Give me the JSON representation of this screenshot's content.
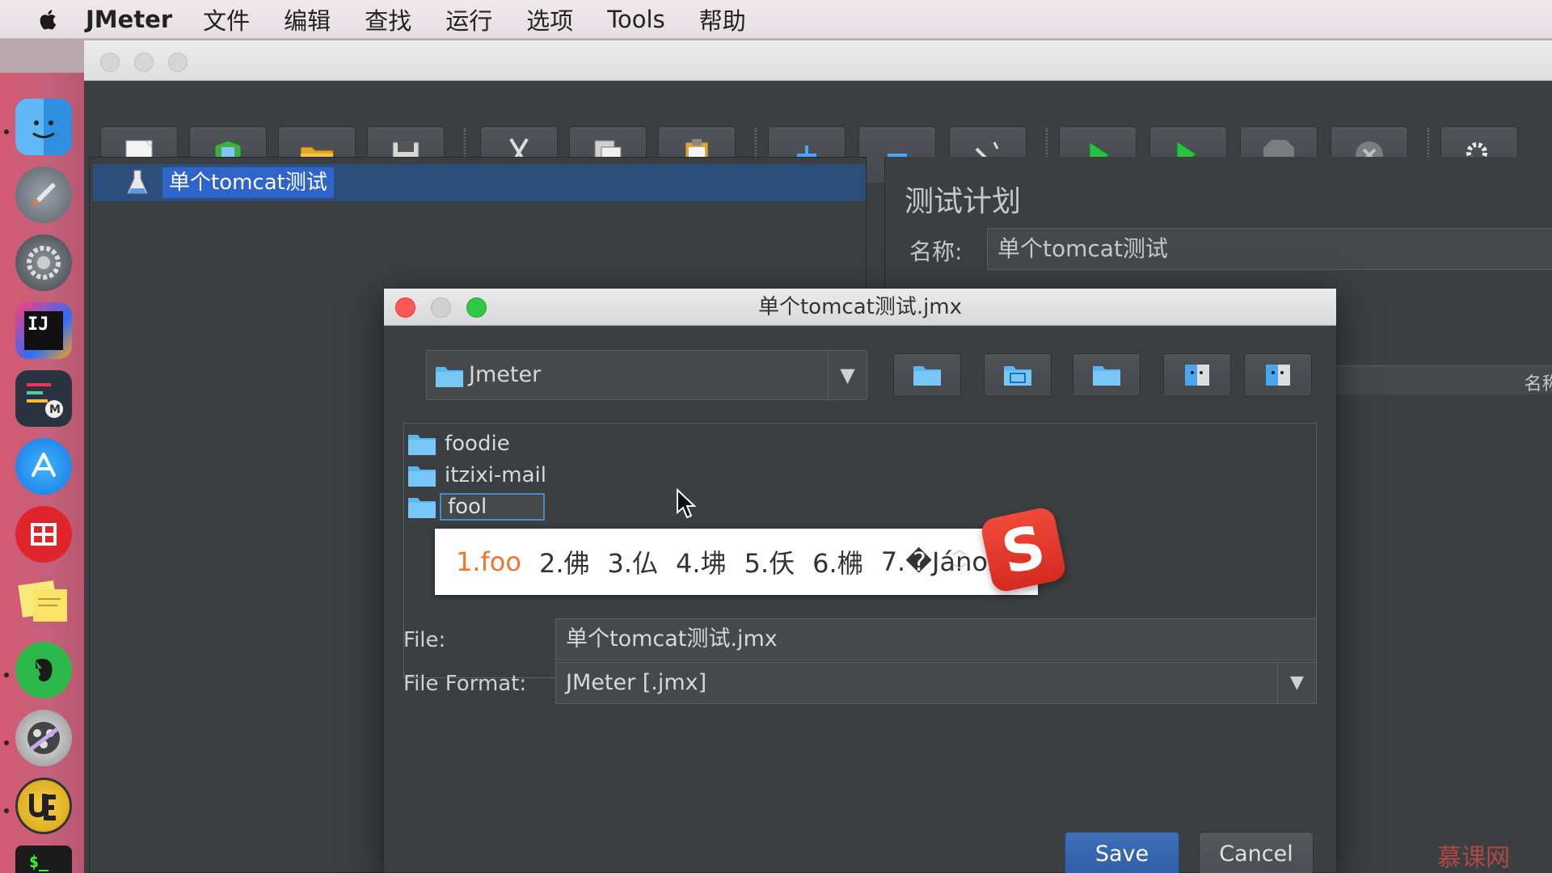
{
  "menubar": {
    "app_name": "JMeter",
    "items": [
      "文件",
      "编辑",
      "查找",
      "运行",
      "选项",
      "Tools",
      "帮助"
    ]
  },
  "toolbar": {
    "buttons": [
      "new",
      "templates",
      "open",
      "save",
      "cut",
      "copy",
      "paste",
      "expand",
      "collapse",
      "toggle",
      "start",
      "start-no-pauses",
      "stop",
      "shutdown",
      "clear"
    ]
  },
  "tree": {
    "root_label": "单个tomcat测试"
  },
  "right_panel": {
    "title": "测试计划",
    "name_label": "名称:",
    "name_value": "单个tomcat测试",
    "strip_label": "名称:"
  },
  "dialog": {
    "title": "单个tomcat测试.jmx",
    "look_in": "Jmeter",
    "folders": [
      "foodie",
      "itzixi-mail"
    ],
    "editing_folder": "fool",
    "file_label": "File:",
    "file_value": "单个tomcat测试.jmx",
    "format_label": "File Format:",
    "format_value": "JMeter [.jmx]",
    "save_label": "Save",
    "cancel_label": "Cancel"
  },
  "ime": {
    "candidates": [
      "1.foo",
      "2.佛",
      "3.仏",
      "4.坲",
      "5.仸",
      "6.梻",
      "7.�János"
    ]
  },
  "watermark": "慕课网",
  "colors": {
    "selection": "#2f65ca",
    "save_button": "#2f5ea6",
    "ime_highlight": "#f0742b",
    "sogou": "#e03a2d"
  }
}
